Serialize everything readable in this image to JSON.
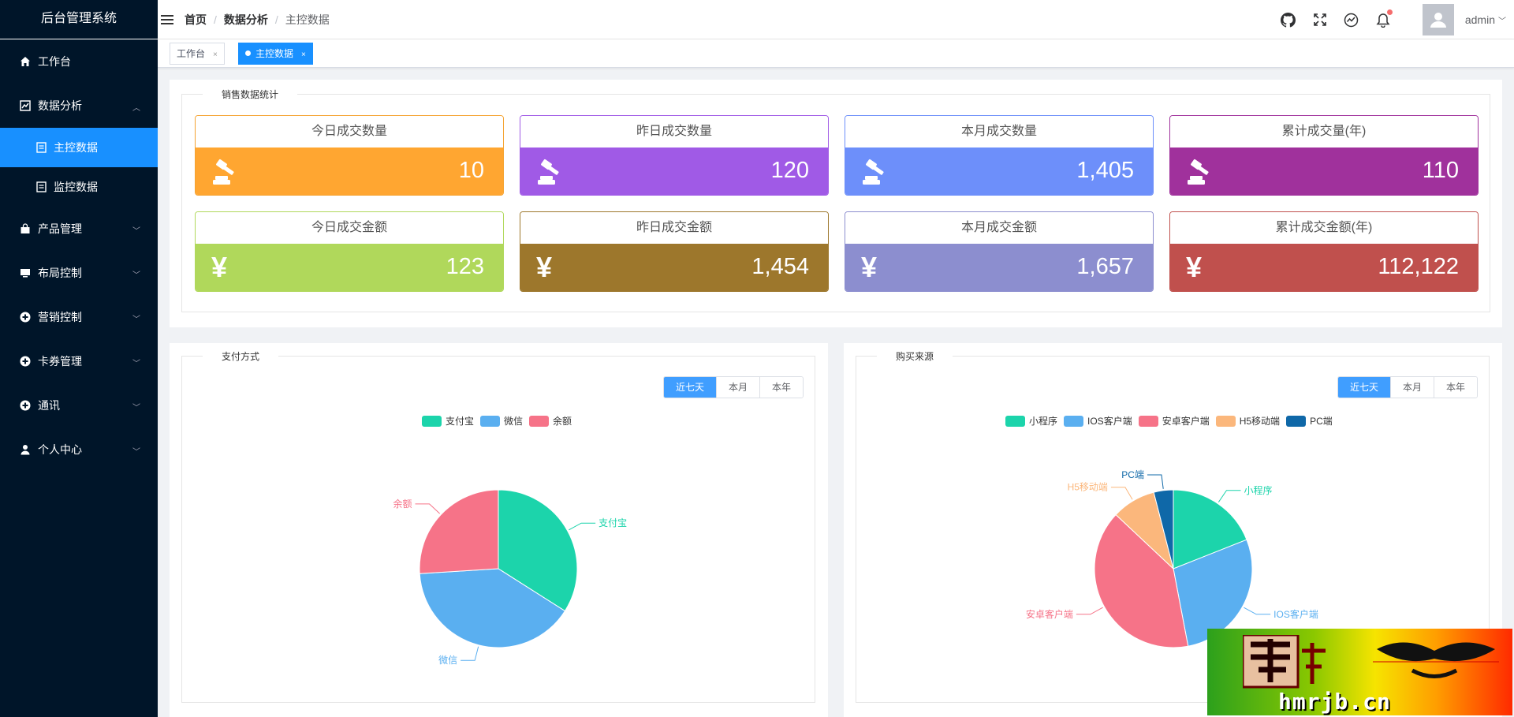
{
  "app": {
    "title": "后台管理系统"
  },
  "sidebar": {
    "items": [
      {
        "label": "工作台",
        "icon": "home-icon"
      },
      {
        "label": "数据分析",
        "icon": "chart-icon",
        "expanded": true,
        "children": [
          {
            "label": "主控数据",
            "icon": "document-icon",
            "active": true
          },
          {
            "label": "监控数据",
            "icon": "document-icon"
          }
        ]
      },
      {
        "label": "产品管理",
        "icon": "bag-icon"
      },
      {
        "label": "布局控制",
        "icon": "monitor-icon"
      },
      {
        "label": "营销控制",
        "icon": "plus-circle-icon"
      },
      {
        "label": "卡券管理",
        "icon": "plus-circle-icon"
      },
      {
        "label": "通讯",
        "icon": "plus-circle-icon"
      },
      {
        "label": "个人中心",
        "icon": "user-icon"
      }
    ]
  },
  "header": {
    "breadcrumb": [
      "首页",
      "数据分析",
      "主控数据"
    ],
    "username": "admin"
  },
  "tabs": [
    {
      "label": "工作台",
      "close": "×"
    },
    {
      "label": "主控数据",
      "close": "×",
      "active": true
    }
  ],
  "sales": {
    "legend": "销售数据统计",
    "cards": [
      {
        "title": "今日成交数量",
        "value": "10",
        "color": "#ffa631",
        "border": "#f5a331",
        "icon": "gavel-icon"
      },
      {
        "title": "昨日成交数量",
        "value": "120",
        "color": "#a05ae6",
        "border": "#a05ae6",
        "icon": "gavel-icon"
      },
      {
        "title": "本月成交数量",
        "value": "1,405",
        "color": "#6d8ffa",
        "border": "#6d8ffa",
        "icon": "gavel-icon"
      },
      {
        "title": "累计成交量(年)",
        "value": "110",
        "color": "#a0319c",
        "border": "#a0319c",
        "icon": "gavel-icon"
      },
      {
        "title": "今日成交金额",
        "value": "123",
        "color": "#b0d85b",
        "border": "#b0d85b",
        "icon": "yen-icon"
      },
      {
        "title": "昨日成交金额",
        "value": "1,454",
        "color": "#9d772c",
        "border": "#9d772c",
        "icon": "yen-icon"
      },
      {
        "title": "本月成交金额",
        "value": "1,657",
        "color": "#8c8ecf",
        "border": "#8c8ecf",
        "icon": "yen-icon"
      },
      {
        "title": "累计成交金额(年)",
        "value": "112,122",
        "color": "#c0504d",
        "border": "#c0504d",
        "icon": "yen-icon"
      }
    ],
    "yen_symbol": "¥"
  },
  "payment": {
    "legend": "支付方式",
    "buttons": [
      "近七天",
      "本月",
      "本年"
    ]
  },
  "source": {
    "legend": "购买来源",
    "buttons": [
      "近七天",
      "本月",
      "本年"
    ]
  },
  "chart_data": [
    {
      "type": "pie",
      "title": "支付方式",
      "categories": [
        "支付宝",
        "微信",
        "余额"
      ],
      "values": [
        34,
        40,
        26
      ],
      "colors": [
        "#1cd4ab",
        "#5aaff0",
        "#f67388"
      ]
    },
    {
      "type": "pie",
      "title": "购买来源",
      "categories": [
        "小程序",
        "IOS客户端",
        "安卓客户端",
        "H5移动端",
        "PC端"
      ],
      "values": [
        19,
        28,
        40,
        9,
        4
      ],
      "colors": [
        "#1cd4ab",
        "#5aaff0",
        "#f67388",
        "#fbb77c",
        "#0f68a8"
      ]
    }
  ],
  "watermark": {
    "text": "hmrjb.cn"
  }
}
